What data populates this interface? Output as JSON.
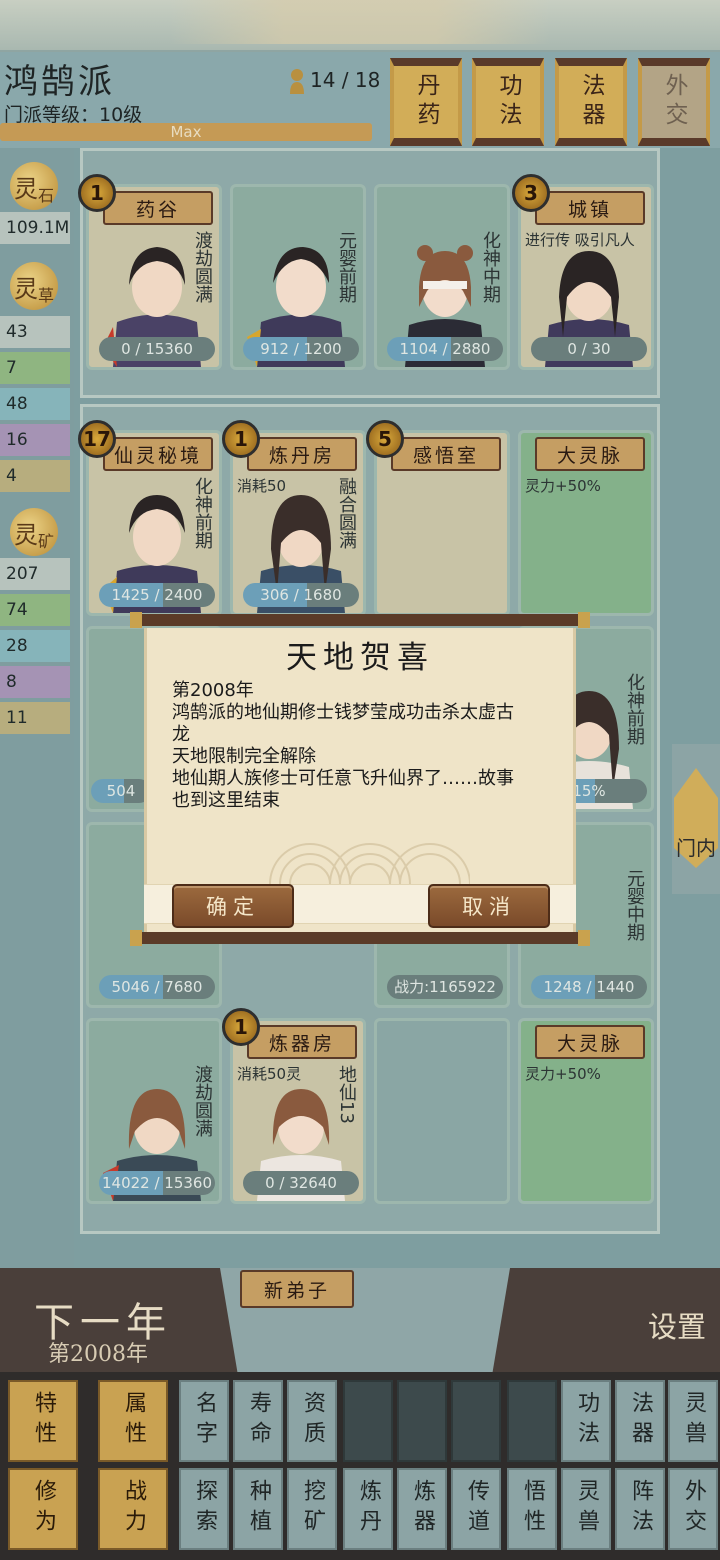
{
  "header": {
    "sect_name": "鸿鹄派",
    "sect_level": "门派等级：10级",
    "level_bar_text": "Max",
    "population": "14 / 18",
    "scroll_tabs": [
      "丹药",
      "功法",
      "法器",
      "外交"
    ]
  },
  "resources": {
    "stone_badge": [
      "灵",
      "石"
    ],
    "stone_value": "109.1M",
    "herb_badge": [
      "灵",
      "草"
    ],
    "herb_values": [
      "43",
      "7",
      "48",
      "16",
      "4"
    ],
    "ore_badge": [
      "灵",
      "矿"
    ],
    "ore_values": [
      "207",
      "74",
      "28",
      "8",
      "11"
    ]
  },
  "row1": {
    "cards": [
      {
        "label": "药谷",
        "count": "1",
        "realm": "渡劫圆满",
        "bar": "0 / 15360"
      },
      {
        "label": "",
        "count": "",
        "realm": "元婴前期",
        "bar": "912 / 1200"
      },
      {
        "label": "",
        "count": "",
        "realm": "化神中期",
        "bar": "1104 / 2880"
      },
      {
        "label": "城镇",
        "count": "3",
        "realm": "",
        "small": "进行传 吸引凡人",
        "bar": "0 / 30"
      }
    ]
  },
  "row2": {
    "cards": [
      {
        "label": "仙灵秘境",
        "count": "17",
        "realm": "化神前期",
        "bar": "1425 / 2400"
      },
      {
        "label": "炼丹房",
        "count": "1",
        "realm": "融合圆满",
        "small": "消耗50",
        "bar": "306 / 1680"
      },
      {
        "label": "感悟室",
        "count": "5"
      },
      {
        "label": "大灵脉",
        "effect": "灵力+50%"
      }
    ]
  },
  "row3": {
    "left_bar": "504",
    "right_realm": "化神前期",
    "right_bar": "15%"
  },
  "row4": {
    "left_bar": "5046 / 7680",
    "mid_bar": "战力:1165922",
    "right_realm": "元婴中期",
    "right_bar": "1248 / 1440"
  },
  "row5": {
    "cards": [
      {
        "realm": "渡劫圆满",
        "bar": "14022 / 15360"
      },
      {
        "label": "炼器房",
        "count": "1",
        "realm": "地仙13",
        "small": "消耗50灵",
        "bar": "0 / 32640"
      },
      {},
      {
        "label": "大灵脉",
        "effect": "灵力+50%"
      }
    ]
  },
  "side_tab": {
    "label": "门内"
  },
  "dialog": {
    "title": "天地贺喜",
    "lines": [
      "第2008年",
      "鸿鹄派的地仙期修士钱梦莹成功击杀太虚古",
      "龙",
      "天地限制完全解除",
      "地仙期人族修士可任意飞升仙界了……故事",
      "也到这里结束"
    ],
    "confirm": "确定",
    "cancel": "取消"
  },
  "bottom": {
    "next_year": "下一年",
    "year": "第2008年",
    "new_disciple": "新弟子",
    "settings": "设置"
  },
  "sort_row1": [
    "特性",
    "属性",
    "名字",
    "寿命",
    "资质",
    "",
    "",
    "",
    "",
    "功法",
    "法器",
    "灵兽"
  ],
  "sort_row2": [
    "修为",
    "战力",
    "探索",
    "种植",
    "挖矿",
    "炼丹",
    "炼器",
    "传道",
    "悟性",
    "灵兽",
    "阵法",
    "外交"
  ],
  "colors": {
    "accent_gold": "#c9a252",
    "dialog_bg": "#efe4c8",
    "button_brown": "#8a5a34",
    "panel_teal": "#8ea9a8"
  }
}
